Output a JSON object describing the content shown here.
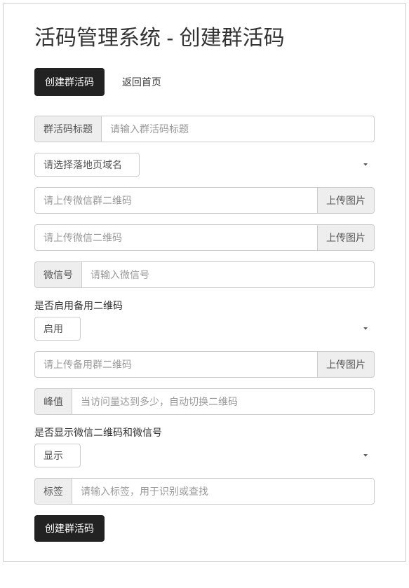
{
  "page": {
    "title": "活码管理系统 - 创建群活码"
  },
  "nav": {
    "create": "创建群活码",
    "home": "返回首页"
  },
  "form": {
    "title_label": "群活码标题",
    "title_placeholder": "请输入群活码标题",
    "domain_placeholder": "请选择落地页域名",
    "group_qr_placeholder": "请上传微信群二维码",
    "wechat_qr_placeholder": "请上传微信二维码",
    "upload_label": "上传图片",
    "wechat_id_label": "微信号",
    "wechat_id_placeholder": "请输入微信号",
    "backup_enable_label": "是否启用备用二维码",
    "backup_enable_value": "启用",
    "backup_qr_placeholder": "请上传备用群二维码",
    "threshold_label": "峰值",
    "threshold_placeholder": "当访问量达到多少，自动切换二维码",
    "show_wechat_label": "是否显示微信二维码和微信号",
    "show_wechat_value": "显示",
    "tag_label": "标签",
    "tag_placeholder": "请输入标签，用于识别或查找",
    "submit_label": "创建群活码"
  }
}
